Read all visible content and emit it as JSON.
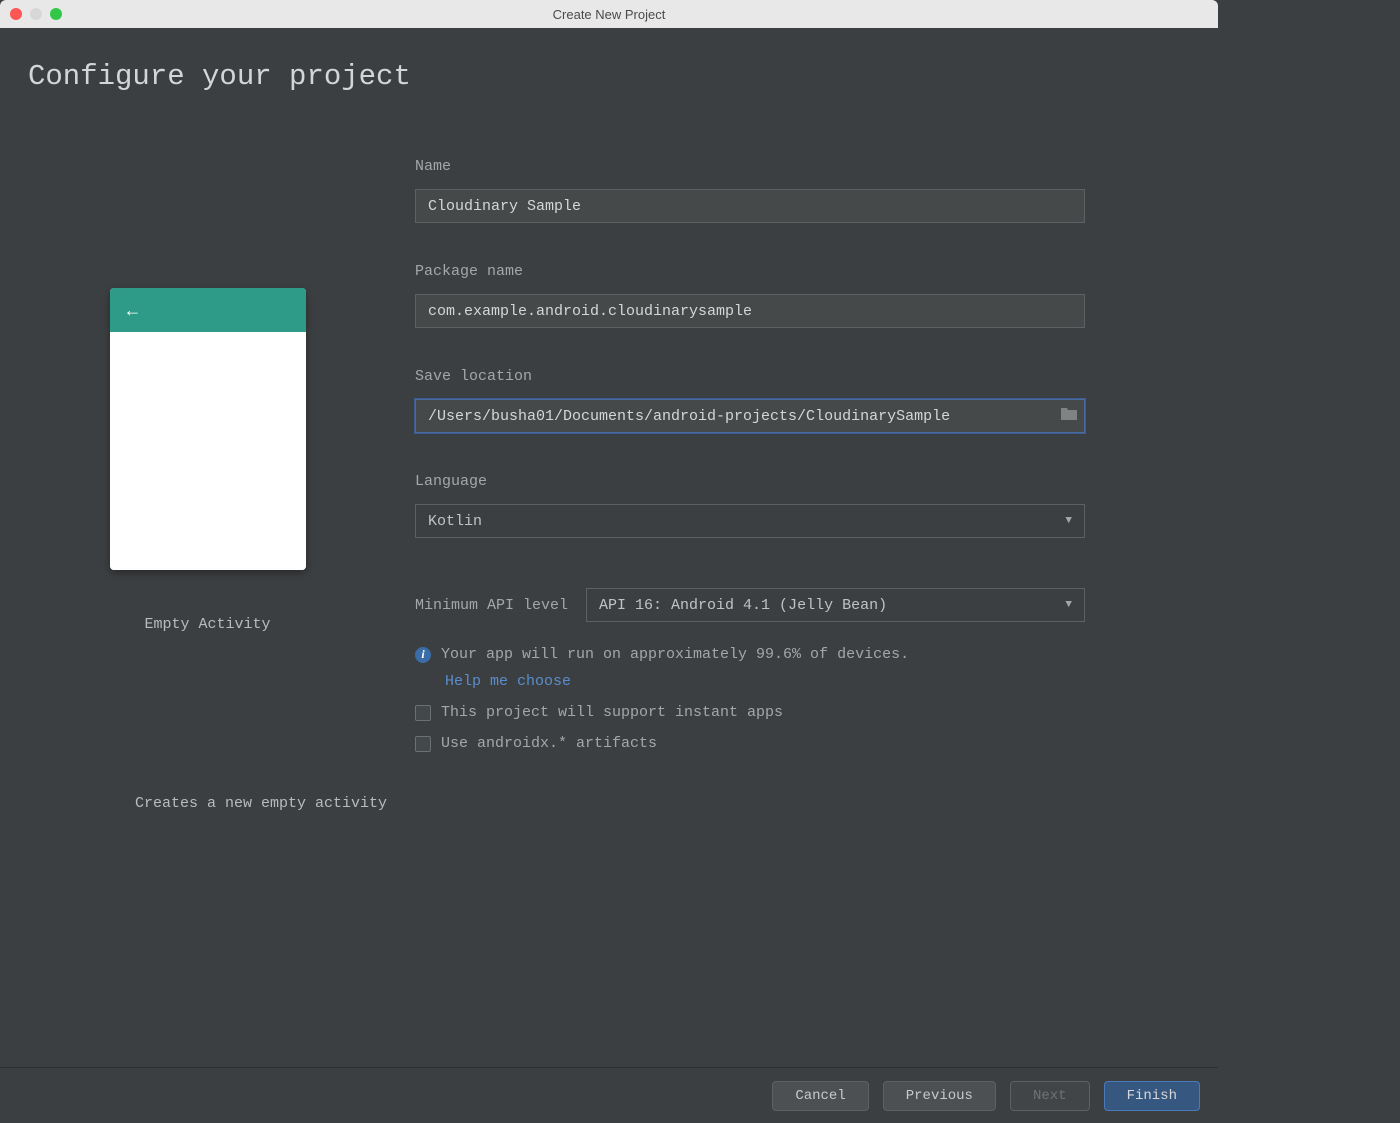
{
  "titlebar": {
    "title": "Create New Project"
  },
  "header": {
    "title": "Configure your project"
  },
  "preview": {
    "label": "Empty Activity",
    "description": "Creates a new empty activity"
  },
  "form": {
    "name_label": "Name",
    "name_value": "Cloudinary Sample",
    "package_label": "Package name",
    "package_value": "com.example.android.cloudinarysample",
    "location_label": "Save location",
    "location_value": "/Users/busha01/Documents/android-projects/CloudinarySample",
    "language_label": "Language",
    "language_value": "Kotlin",
    "api_label": "Minimum API level",
    "api_value": "API 16: Android 4.1 (Jelly Bean)",
    "info_text": "Your app will run on approximately 99.6% of devices.",
    "help_link": "Help me choose",
    "instant_apps_label": "This project will support instant apps",
    "androidx_label": "Use androidx.* artifacts"
  },
  "footer": {
    "cancel": "Cancel",
    "previous": "Previous",
    "next": "Next",
    "finish": "Finish"
  }
}
